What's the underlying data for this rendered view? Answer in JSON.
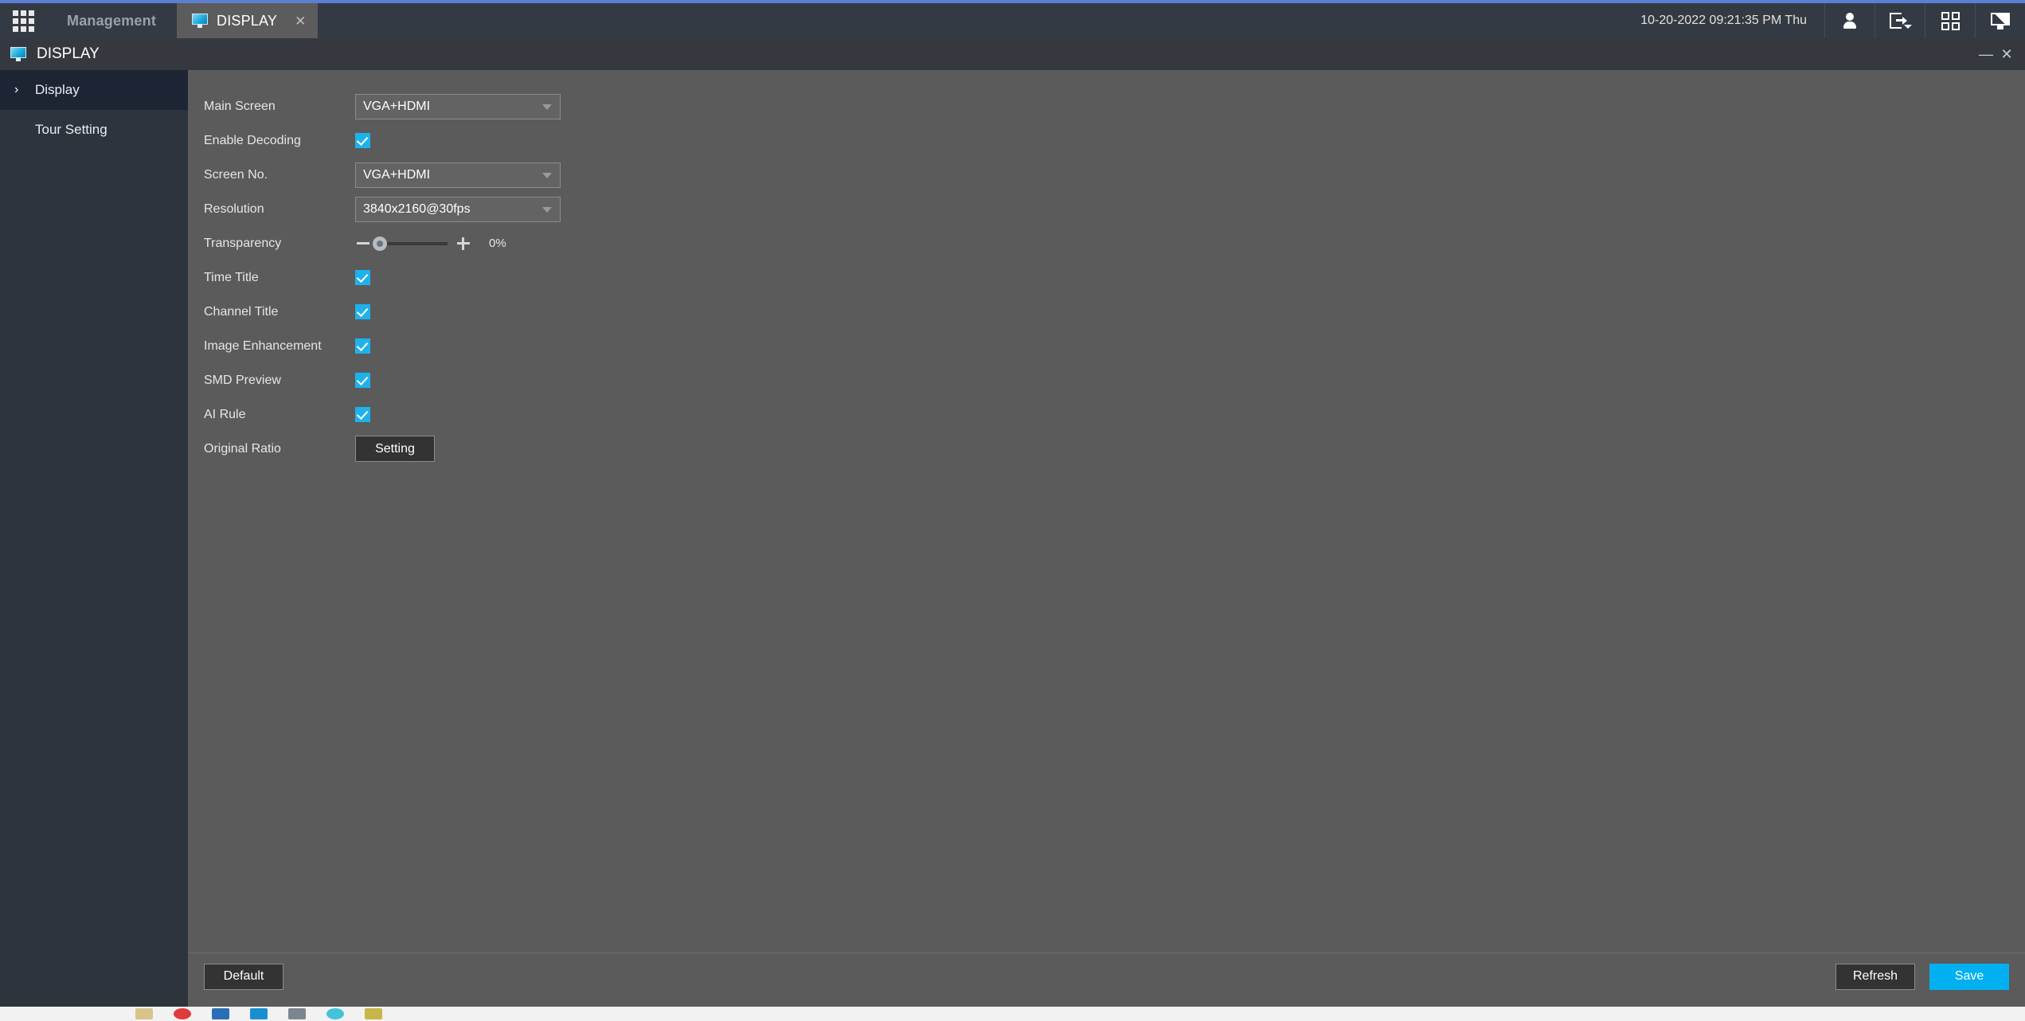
{
  "window": {
    "accent_color": "#5b7fd4",
    "minimize_label": "—",
    "close_label": "✕"
  },
  "tabbar": {
    "grid_icon": "apps-grid-icon",
    "tabs": [
      {
        "label": "Management",
        "active": false,
        "icon": ""
      },
      {
        "label": "DISPLAY",
        "active": true,
        "icon": "monitor-icon",
        "close_label": "✕"
      }
    ],
    "clock": "10-20-2022 09:21:35 PM Thu",
    "actions": [
      {
        "name": "user-icon",
        "label": ""
      },
      {
        "name": "logout-icon",
        "label": ""
      },
      {
        "name": "qr-code-icon",
        "label": ""
      },
      {
        "name": "display-monitor-icon",
        "label": ""
      }
    ]
  },
  "page_header": {
    "icon": "monitor-icon",
    "title": "DISPLAY"
  },
  "sidebar": {
    "items": [
      {
        "label": "Display",
        "active": true,
        "chevron": "›"
      },
      {
        "label": "Tour Setting",
        "active": false,
        "chevron": ""
      }
    ]
  },
  "form": {
    "main_screen": {
      "label": "Main Screen",
      "value": "VGA+HDMI"
    },
    "enable_decoding": {
      "label": "Enable Decoding",
      "checked": true
    },
    "screen_no": {
      "label": "Screen No.",
      "value": "VGA+HDMI"
    },
    "resolution": {
      "label": "Resolution",
      "value": "3840x2160@30fps"
    },
    "transparency": {
      "label": "Transparency",
      "value": "0%",
      "percent": 0,
      "minus": "−",
      "plus": "+"
    },
    "time_title": {
      "label": "Time Title",
      "checked": true
    },
    "channel_title": {
      "label": "Channel Title",
      "checked": true
    },
    "image_enhancement": {
      "label": "Image Enhancement",
      "checked": true
    },
    "smd_preview": {
      "label": "SMD Preview",
      "checked": true
    },
    "ai_rule": {
      "label": "AI Rule",
      "checked": true
    },
    "original_ratio": {
      "label": "Original Ratio",
      "button_label": "Setting"
    }
  },
  "footer": {
    "default_label": "Default",
    "refresh_label": "Refresh",
    "save_label": "Save",
    "save_color": "#00b0f0"
  }
}
